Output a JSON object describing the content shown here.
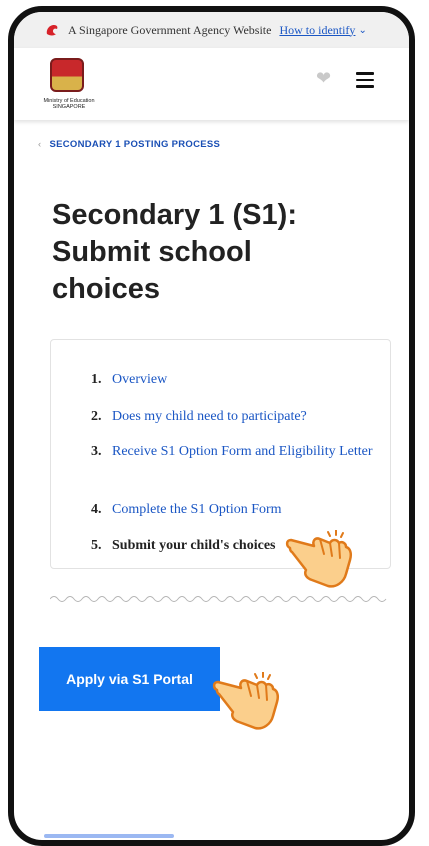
{
  "gov_banner": {
    "text": "A Singapore Government Agency Website",
    "link": "How to identify"
  },
  "header": {
    "logo_line1": "Ministry of Education",
    "logo_line2": "SINGAPORE"
  },
  "breadcrumb": {
    "label": "SECONDARY 1 POSTING PROCESS"
  },
  "page": {
    "title": "Secondary 1 (S1): Submit school choices"
  },
  "toc": {
    "items": [
      {
        "num": "1.",
        "label": "Overview"
      },
      {
        "num": "2.",
        "label": "Does my child need to participate?"
      },
      {
        "num": "3.",
        "label": "Receive S1 Option Form and Eligibility Letter"
      },
      {
        "num": "4.",
        "label": "Complete the S1 Option Form"
      },
      {
        "num": "5.",
        "label": "Submit your child's choices"
      }
    ]
  },
  "cta": {
    "apply_label": "Apply via S1 Portal"
  },
  "icons": {
    "gov_lion": "lion-head-icon",
    "heart": "heart-icon",
    "menu": "hamburger-menu-icon",
    "pointer": "pointing-hand-icon"
  },
  "colors": {
    "link": "#1a56c4",
    "button": "#1276f0",
    "crest_red": "#c8282b"
  }
}
